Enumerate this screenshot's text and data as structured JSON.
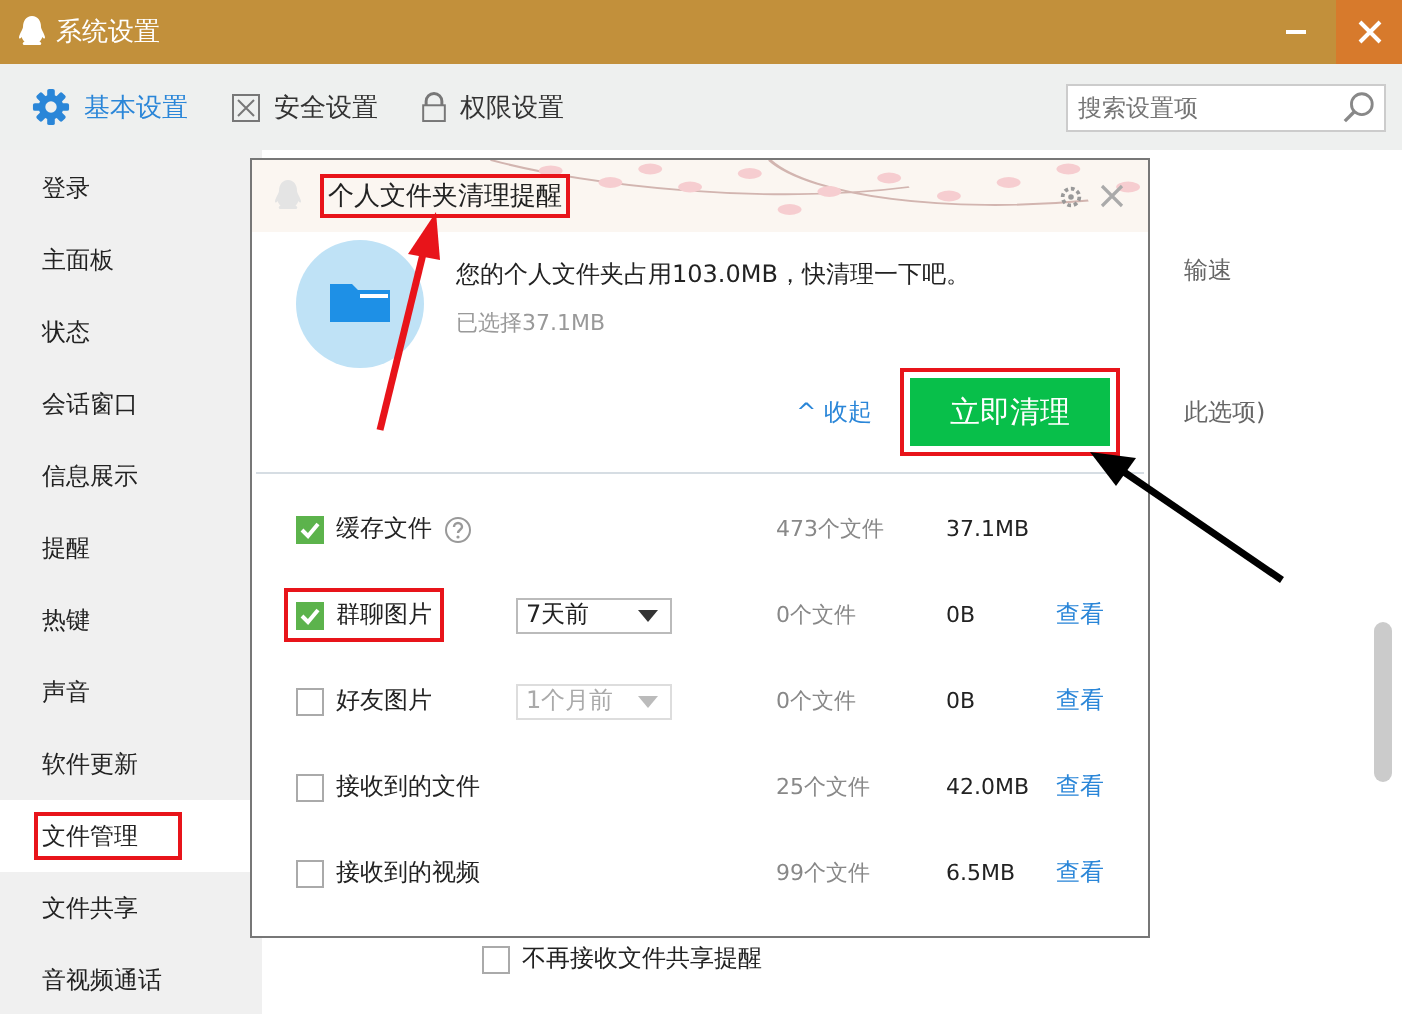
{
  "window": {
    "title": "系统设置"
  },
  "tabs": [
    {
      "label": "基本设置",
      "selected": true
    },
    {
      "label": "安全设置",
      "selected": false
    },
    {
      "label": "权限设置",
      "selected": false
    }
  ],
  "search": {
    "placeholder": "搜索设置项"
  },
  "sidebar": {
    "items": [
      {
        "label": "登录",
        "selected": false,
        "annotated": false
      },
      {
        "label": "主面板",
        "selected": false,
        "annotated": false
      },
      {
        "label": "状态",
        "selected": false,
        "annotated": false
      },
      {
        "label": "会话窗口",
        "selected": false,
        "annotated": false
      },
      {
        "label": "信息展示",
        "selected": false,
        "annotated": false
      },
      {
        "label": "提醒",
        "selected": false,
        "annotated": false
      },
      {
        "label": "热键",
        "selected": false,
        "annotated": false
      },
      {
        "label": "声音",
        "selected": false,
        "annotated": false
      },
      {
        "label": "软件更新",
        "selected": false,
        "annotated": false
      },
      {
        "label": "文件管理",
        "selected": true,
        "annotated": true
      },
      {
        "label": "文件共享",
        "selected": false,
        "annotated": false
      },
      {
        "label": "音视频通话",
        "selected": false,
        "annotated": false
      }
    ]
  },
  "background": {
    "texts": [
      "输速",
      "此选项)"
    ],
    "option": {
      "label": "不再接收文件共享提醒",
      "checked": false
    }
  },
  "popup": {
    "title": "个人文件夹清理提醒",
    "title_annotated": true,
    "message": "您的个人文件夹占用103.0MB，快清理一下吧。",
    "selected_size": "已选择37.1MB",
    "collapse_link": "收起",
    "collapse_icon": "^",
    "clean_button": {
      "label": "立即清理",
      "annotated": true
    },
    "rows": [
      {
        "label": "缓存文件",
        "checked": true,
        "help": true,
        "annotated": false,
        "count": "473个文件",
        "size": "37.1MB"
      },
      {
        "label": "群聊图片",
        "checked": true,
        "help": false,
        "annotated": true,
        "dropdown": {
          "value": "7天前",
          "disabled": false
        },
        "count": "0个文件",
        "size": "0B",
        "view_link": "查看"
      },
      {
        "label": "好友图片",
        "checked": false,
        "help": false,
        "annotated": false,
        "dropdown": {
          "value": "1个月前",
          "disabled": true
        },
        "count": "0个文件",
        "size": "0B",
        "view_link": "查看"
      },
      {
        "label": "接收到的文件",
        "checked": false,
        "help": false,
        "annotated": false,
        "count": "25个文件",
        "size": "42.0MB",
        "view_link": "查看"
      },
      {
        "label": "接收到的视频",
        "checked": false,
        "help": false,
        "annotated": false,
        "count": "99个文件",
        "size": "6.5MB",
        "view_link": "查看"
      }
    ]
  }
}
